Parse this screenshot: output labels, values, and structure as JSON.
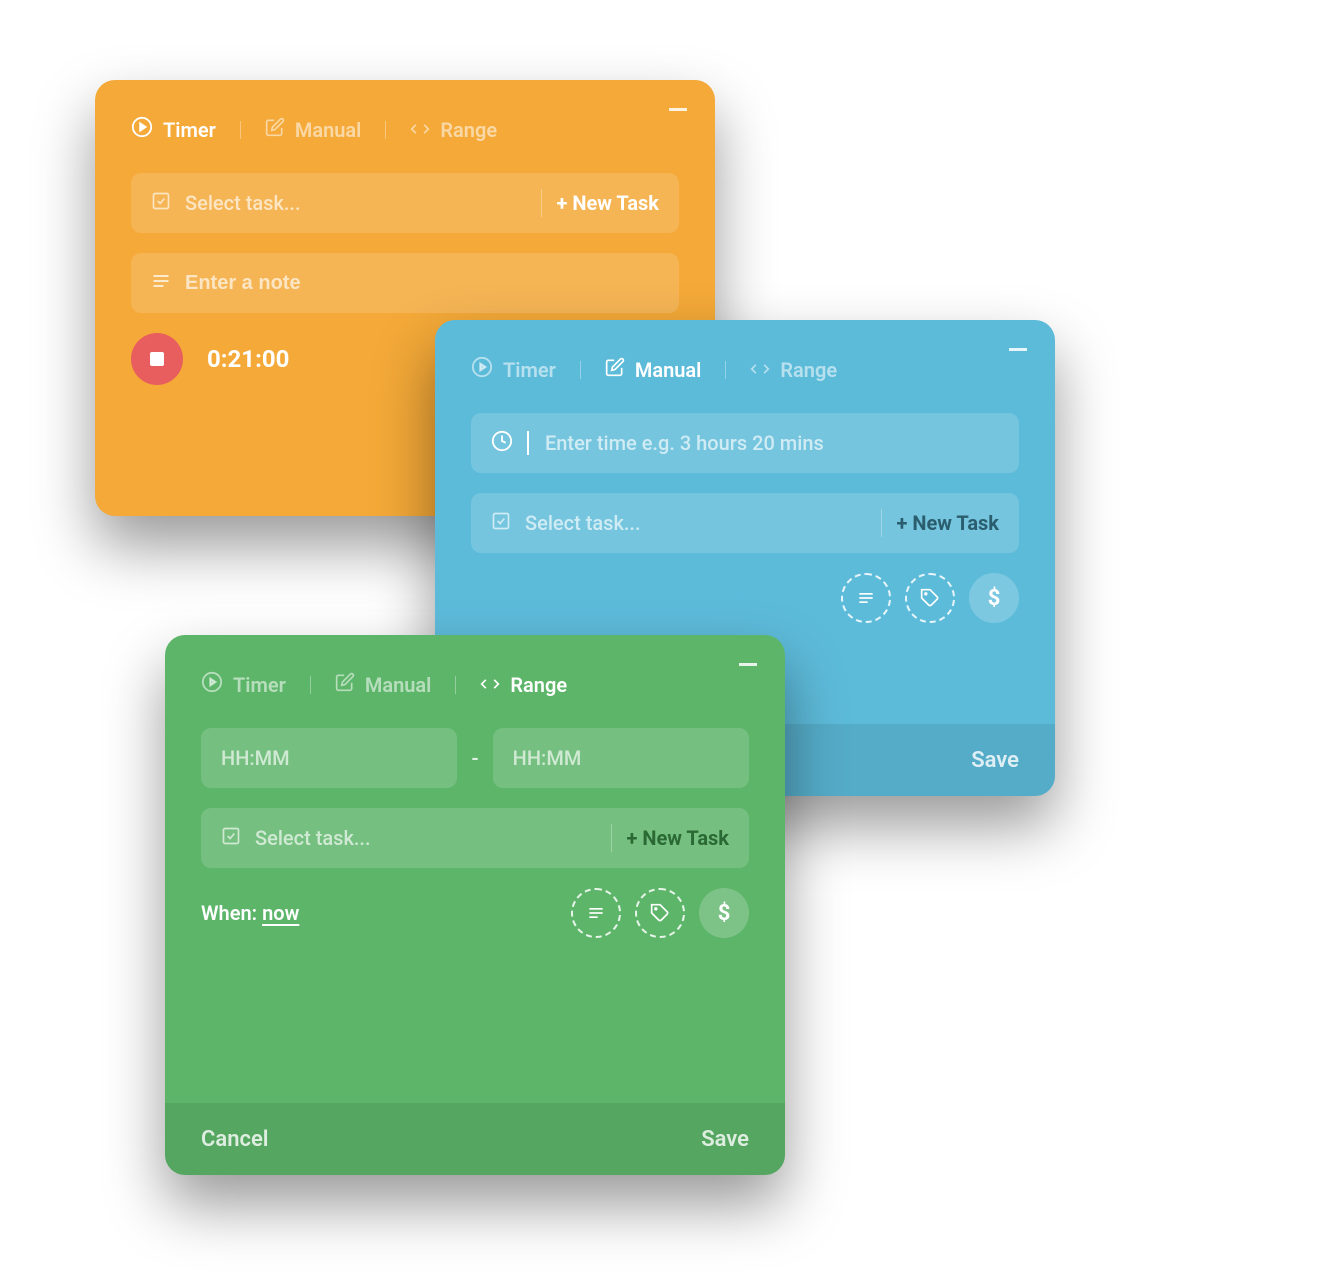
{
  "tabs": {
    "timer": "Timer",
    "manual": "Manual",
    "range": "Range"
  },
  "common": {
    "select_task": "Select task...",
    "new_task": "+ New Task",
    "save": "Save",
    "cancel": "Cancel"
  },
  "orange": {
    "note_placeholder": "Enter a note",
    "timer_value": "0:21:00"
  },
  "blue": {
    "time_placeholder": "Enter time e.g. 3 hours 20 mins",
    "dollar": "$"
  },
  "green": {
    "hhmm": "HH:MM",
    "when_label": "When: ",
    "when_value": "now",
    "dollar": "$"
  }
}
